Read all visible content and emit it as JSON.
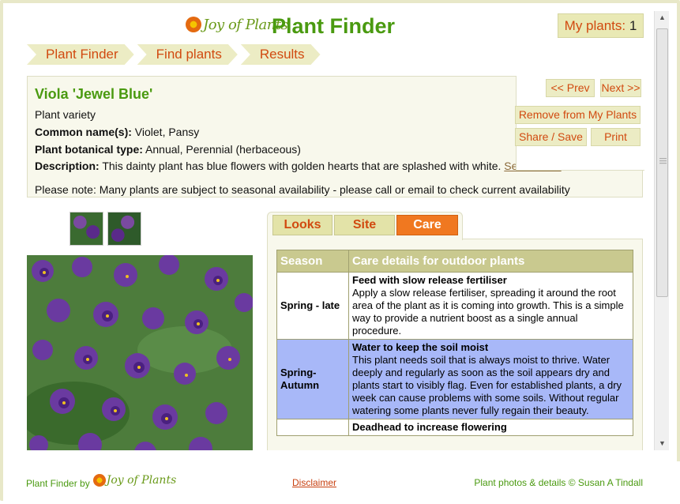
{
  "header": {
    "logo_text": "Joy of Plants",
    "title": "Plant Finder",
    "my_plants_label": "My plants:",
    "my_plants_count": "1"
  },
  "breadcrumbs": [
    "Plant Finder",
    "Find plants",
    "Results"
  ],
  "nav": {
    "prev": "<< Prev",
    "next": "Next >>",
    "remove": "Remove from My Plants",
    "share": "Share / Save",
    "print": "Print"
  },
  "plant": {
    "name": "Viola 'Jewel Blue'",
    "category": "Plant variety",
    "common_label": "Common name(s):",
    "common_value": "Violet, Pansy",
    "type_label": "Plant botanical type:",
    "type_value": "Annual, Perennial (herbaceous)",
    "desc_label": "Description:",
    "desc_value": "This dainty plant has blue flowers with golden hearts that are splashed with white.",
    "see_more": "See more »",
    "note": "Please note: Many plants are subject to seasonal availability - please call or email to check current availability"
  },
  "tabs": [
    {
      "label": "Looks",
      "active": false
    },
    {
      "label": "Site",
      "active": false
    },
    {
      "label": "Care",
      "active": true
    }
  ],
  "care_table": {
    "col_season": "Season",
    "col_details": "Care details for outdoor plants",
    "rows": [
      {
        "season": "Spring - late",
        "title": "Feed with slow release fertiliser",
        "text": "Apply a slow release fertiliser, spreading it around the root area of the plant as it is coming into growth. This is a simple way to provide a nutrient boost as a single annual procedure."
      },
      {
        "season": "Spring-Autumn",
        "title": "Water to keep the soil moist",
        "text": "This plant needs soil that is always moist to thrive. Water deeply and regularly as soon as the soil appears dry and plants start to visibly flag. Even for established plants, a dry week can cause problems with some soils. Without regular watering some plants never fully regain their beauty."
      },
      {
        "season": "",
        "title": "Deadhead to increase flowering",
        "text": ""
      }
    ]
  },
  "footer": {
    "by_label": "Plant Finder by",
    "logo_text": "Joy of Plants",
    "disclaimer": "Disclaimer",
    "credit": "Plant photos & details © Susan A Tindall"
  },
  "colors": {
    "brand_green": "#4a9a10",
    "accent_orange": "#d14a10",
    "active_tab": "#f07820",
    "highlight_row": "#a8b8f8"
  }
}
